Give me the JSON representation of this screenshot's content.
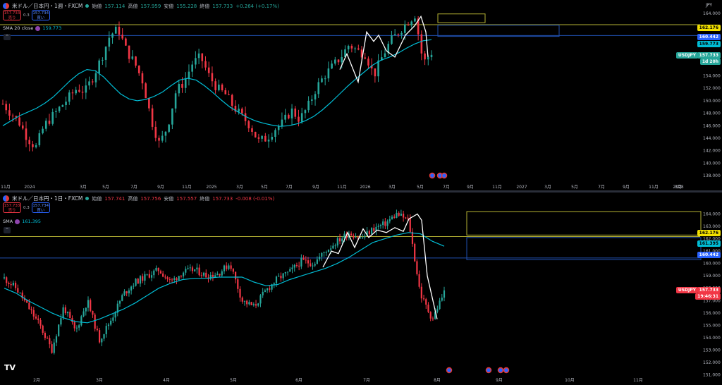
{
  "colors": {
    "up": "#26a69a",
    "down": "#f23645",
    "sma": "#00bcd4",
    "yellow_line": "#b5b233",
    "blue_line": "#2150b0",
    "wave": "#ffffff",
    "tag_yellow": "#f2e000",
    "tag_blue": "#2962ff",
    "tag_cyan": "#00bcd4",
    "tag_price_up": "#26a69a",
    "tag_price_down": "#f23645"
  },
  "top": {
    "symbol": "米ドル／日本円・1週・FXCM",
    "open_label": "始値",
    "open": "157.114",
    "high_label": "高値",
    "high": "157.959",
    "low_label": "安値",
    "low": "155.228",
    "close_label": "終値",
    "close": "157.733",
    "change": "+0.264 (+0.17%)",
    "sell_price": "157.733",
    "sell_label": "売り",
    "spread": "0.3",
    "buy_price": "157.734",
    "buy_label": "買い",
    "sma_label": "SMA 20 close",
    "sma_value": "159.773",
    "currency": "JPY",
    "collapse": "^",
    "price_tags": {
      "yellow": "162.176",
      "blue": "160.442",
      "sma": "159.773",
      "symbol": "USDJPY",
      "price": "157.733",
      "countdown": "1d 20h"
    }
  },
  "bottom": {
    "symbol": "米ドル／日本円・1日・FXCM",
    "open_label": "始値",
    "open": "157.741",
    "high_label": "高値",
    "high": "157.756",
    "low_label": "安値",
    "low": "157.557",
    "close_label": "終値",
    "close": "157.733",
    "change": "-0.008 (-0.01%)",
    "sell_price": "157.733",
    "sell_label": "売り",
    "spread": "0.3",
    "buy_price": "157.734",
    "buy_label": "買い",
    "sma_label": "SMA",
    "sma_value": "161.395",
    "collapse": "^",
    "price_tags": {
      "yellow": "162.176",
      "sma": "161.395",
      "blue": "160.442",
      "symbol": "USDJPY",
      "price": "157.733",
      "countdown": "19:46:31"
    }
  },
  "logo": "TV",
  "chart_data": [
    {
      "type": "candlestick",
      "title": "米ドル／日本円・1週・FXCM",
      "ylim": [
        137,
        165
      ],
      "y_ticks": [
        "164.000",
        "156.000",
        "154.000",
        "152.000",
        "150.000",
        "148.000",
        "146.000",
        "144.000",
        "142.000",
        "140.000",
        "138.000"
      ],
      "x_ticks": [
        "11月",
        "2024",
        "3月",
        "5月",
        "7月",
        "9月",
        "11月",
        "2025",
        "3月",
        "5月",
        "7月",
        "9月",
        "11月",
        "2026",
        "3月",
        "5月",
        "7月",
        "9月",
        "11月",
        "2027",
        "3月",
        "5月",
        "7月",
        "9月",
        "11月",
        "2028",
        "3月"
      ],
      "horizontal_lines": [
        162.176,
        160.442
      ],
      "sma_period": 20,
      "series": [
        {
          "name": "SMA 20 close",
          "values": [
            146.0,
            146.8,
            147.6,
            148.2,
            148.8,
            149.6,
            150.6,
            151.9,
            153.2,
            154.3,
            155.0,
            154.8,
            153.8,
            152.4,
            151.1,
            150.3,
            150.0,
            150.2,
            150.7,
            151.4,
            152.4,
            153.3,
            153.6,
            153.3,
            152.4,
            151.3,
            150.1,
            149.0,
            148.2,
            147.4,
            146.8,
            146.4,
            146.1,
            145.9,
            146.0,
            146.3,
            146.8,
            147.5,
            148.5,
            149.7,
            151.0,
            152.3,
            153.5,
            154.6,
            155.7,
            156.5,
            157.0,
            157.6,
            158.4,
            159.1,
            159.6,
            159.773
          ]
        }
      ],
      "approx_close_path": [
        149.5,
        148.0,
        146.5,
        144.0,
        142.5,
        146.0,
        147.5,
        149.0,
        150.5,
        152.0,
        151.5,
        154.0,
        157.0,
        160.5,
        161.5,
        158.0,
        156.0,
        153.0,
        147.0,
        143.0,
        146.0,
        151.5,
        153.0,
        156.0,
        157.0,
        154.0,
        152.0,
        151.0,
        149.0,
        147.5,
        146.0,
        143.5,
        144.0,
        145.5,
        146.5,
        148.5,
        147.0,
        149.0,
        152.0,
        154.0,
        155.5,
        157.0,
        159.0,
        158.0,
        157.5,
        154.0,
        157.0,
        159.5,
        161.0,
        162.5,
        163.8,
        156.0,
        157.733
      ]
    },
    {
      "type": "candlestick",
      "title": "米ドル／日本円・1日・FXCM",
      "ylim": [
        150.8,
        164.6
      ],
      "y_ticks": [
        "164.000",
        "163.000",
        "162.000",
        "161.000",
        "160.000",
        "159.000",
        "158.000",
        "157.000",
        "156.000",
        "155.000",
        "154.000",
        "153.000",
        "152.000",
        "151.000"
      ],
      "x_ticks": [
        "2月",
        "3月",
        "4月",
        "5月",
        "6月",
        "7月",
        "8月",
        "9月",
        "10月",
        "11月"
      ],
      "horizontal_lines": [
        162.176,
        160.442
      ],
      "series": [
        {
          "name": "SMA",
          "values": [
            158.0,
            157.6,
            157.0,
            156.5,
            156.0,
            155.6,
            155.3,
            155.2,
            155.5,
            155.9,
            156.3,
            156.8,
            157.4,
            158.0,
            158.4,
            158.7,
            158.8,
            158.8,
            158.9,
            158.9,
            158.9,
            158.5,
            158.2,
            158.3,
            158.7,
            159.0,
            159.3,
            159.6,
            160.0,
            160.5,
            161.1,
            161.7,
            162.0,
            162.3,
            162.5,
            162.4,
            161.8,
            161.395
          ]
        }
      ],
      "approx_close_path": [
        158.8,
        158.0,
        156.5,
        155.0,
        153.0,
        156.5,
        154.5,
        157.0,
        153.8,
        155.5,
        157.5,
        158.5,
        159.0,
        159.5,
        158.5,
        159.3,
        159.5,
        159.0,
        159.2,
        160.0,
        157.0,
        156.5,
        157.8,
        158.8,
        159.3,
        160.2,
        160.0,
        161.0,
        161.8,
        162.5,
        162.0,
        162.8,
        163.2,
        164.0,
        163.5,
        157.5,
        155.5,
        157.7
      ]
    }
  ]
}
